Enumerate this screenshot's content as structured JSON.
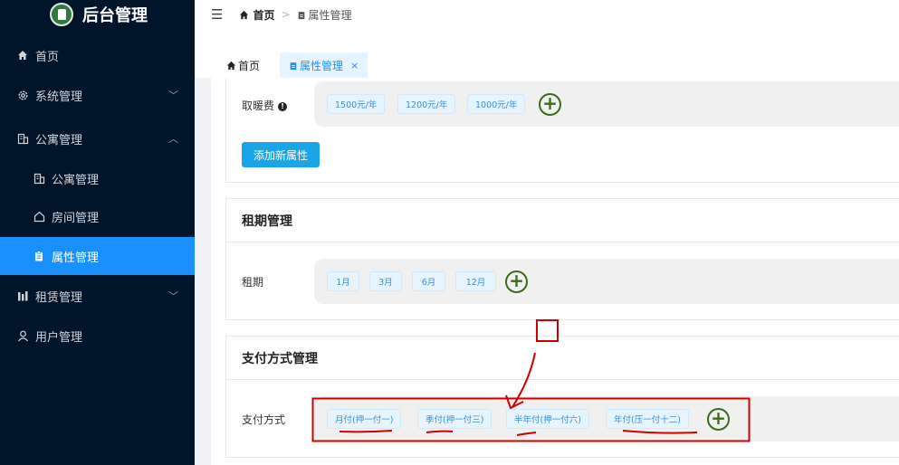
{
  "app": {
    "title": "后台管理"
  },
  "sidebar": {
    "items": [
      {
        "label": "首页",
        "icon": "home-icon"
      },
      {
        "label": "系统管理",
        "icon": "gear-icon",
        "arrow": "﹀"
      },
      {
        "label": "公寓管理",
        "icon": "building-icon",
        "arrow": "︿"
      },
      {
        "label": "公寓管理",
        "icon": "building-icon"
      },
      {
        "label": "房间管理",
        "icon": "house-outline-icon"
      },
      {
        "label": "属性管理",
        "icon": "clipboard-icon",
        "active": true
      },
      {
        "label": "租赁管理",
        "icon": "chart-icon",
        "arrow": "﹀"
      },
      {
        "label": "用户管理",
        "icon": "user-icon"
      }
    ]
  },
  "breadcrumb": {
    "home": "首页",
    "separator": ">",
    "current": "属性管理"
  },
  "tabs": [
    {
      "label": "首页"
    },
    {
      "label": "属性管理",
      "close": "×"
    }
  ],
  "heating": {
    "label": "取暖费",
    "info": "!",
    "tags": [
      "1500元/年",
      "1200元/年",
      "1000元/年"
    ],
    "add": "+",
    "add_attr_button": "添加新属性"
  },
  "lease": {
    "title": "租期管理",
    "label": "租期",
    "tags": [
      "1月",
      "3月",
      "6月",
      "12月"
    ],
    "add": "+"
  },
  "payment": {
    "title": "支付方式管理",
    "label": "支付方式",
    "tags": [
      "月付(押一付一)",
      "季付(押一付三)",
      "半年付(押一付六)",
      "年付(压一付十二)"
    ],
    "add": "+"
  },
  "colors": {
    "sidebar": "#001529",
    "accent": "#1890ff",
    "annotation": "#d00000"
  }
}
